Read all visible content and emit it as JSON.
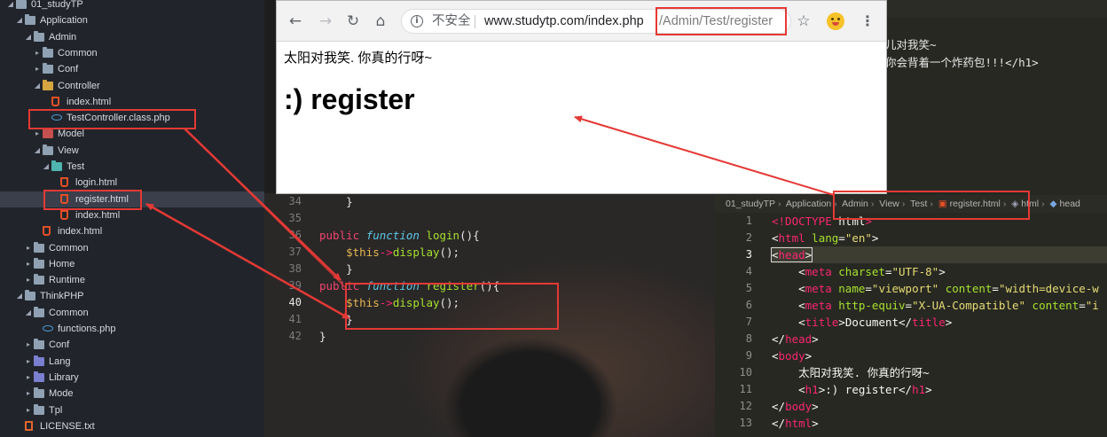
{
  "sidebar": {
    "items": [
      {
        "label": "01_studyTP",
        "depth": 0,
        "expanded": true,
        "icon": "folder-icon"
      },
      {
        "label": "Application",
        "depth": 1,
        "expanded": true,
        "icon": "folder-icon"
      },
      {
        "label": "Admin",
        "depth": 2,
        "expanded": true,
        "icon": "folder-icon"
      },
      {
        "label": "Common",
        "depth": 3,
        "expanded": false,
        "icon": "folder-icon"
      },
      {
        "label": "Conf",
        "depth": 3,
        "expanded": false,
        "icon": "folder-icon"
      },
      {
        "label": "Controller",
        "depth": 3,
        "expanded": true,
        "icon": "folder-icon"
      },
      {
        "label": "index.html",
        "depth": 4,
        "icon": "html5-icon"
      },
      {
        "label": "TestController.class.php",
        "depth": 4,
        "icon": "php-icon"
      },
      {
        "label": "Model",
        "depth": 3,
        "expanded": false,
        "icon": "folder-icon"
      },
      {
        "label": "View",
        "depth": 3,
        "expanded": true,
        "icon": "folder-icon"
      },
      {
        "label": "Test",
        "depth": 4,
        "expanded": true,
        "icon": "folder-icon"
      },
      {
        "label": "login.html",
        "depth": 5,
        "icon": "html5-icon"
      },
      {
        "label": "register.html",
        "depth": 5,
        "icon": "html5-icon",
        "selected": true
      },
      {
        "label": "index.html",
        "depth": 5,
        "icon": "html5-icon"
      },
      {
        "label": "index.html",
        "depth": 3,
        "icon": "html5-icon"
      },
      {
        "label": "Common",
        "depth": 2,
        "expanded": false,
        "icon": "folder-icon"
      },
      {
        "label": "Home",
        "depth": 2,
        "expanded": false,
        "icon": "folder-icon"
      },
      {
        "label": "Runtime",
        "depth": 2,
        "expanded": false,
        "icon": "folder-icon"
      },
      {
        "label": "ThinkPHP",
        "depth": 1,
        "expanded": true,
        "icon": "folder-icon"
      },
      {
        "label": "Common",
        "depth": 2,
        "expanded": true,
        "icon": "folder-icon"
      },
      {
        "label": "functions.php",
        "depth": 3,
        "icon": "php-icon"
      },
      {
        "label": "Conf",
        "depth": 2,
        "expanded": false,
        "icon": "folder-icon"
      },
      {
        "label": "Lang",
        "depth": 2,
        "expanded": false,
        "icon": "folder-icon"
      },
      {
        "label": "Library",
        "depth": 2,
        "expanded": false,
        "icon": "folder-icon"
      },
      {
        "label": "Mode",
        "depth": 2,
        "expanded": false,
        "icon": "folder-icon"
      },
      {
        "label": "Tpl",
        "depth": 2,
        "expanded": false,
        "icon": "folder-icon"
      },
      {
        "label": "LICENSE.txt",
        "depth": 1,
        "icon": "file-icon"
      }
    ]
  },
  "center_editor": {
    "line_numbers": [
      "34",
      "35",
      "36",
      "37",
      "38",
      "39",
      "40",
      "41",
      "42"
    ],
    "active_line": "40",
    "lines": [
      {
        "indent": "    ",
        "text": "}"
      },
      {
        "indent": "",
        "text": ""
      },
      {
        "kw": "public",
        "fkw": "function",
        "name": "login",
        "rest": "(){"
      },
      {
        "var": "$this",
        "arrow": "->",
        "call": "display",
        "rest": "();"
      },
      {
        "indent": "    ",
        "text": "}"
      },
      {
        "kw": "public",
        "fkw": "function",
        "name": "register",
        "rest": "(){"
      },
      {
        "var": "$this",
        "arrow": "->",
        "call": "display",
        "rest": "();"
      },
      {
        "indent": "    ",
        "text": "}"
      },
      {
        "indent": "",
        "text": "}"
      }
    ]
  },
  "right_editor": {
    "top_lines": [
      "儿对我笑~",
      "你会背着一个炸药包!!!</h1>"
    ],
    "breadcrumb": [
      "01_studyTP",
      "Application",
      "Admin",
      "View",
      "Test",
      "register.html",
      "html",
      "head"
    ],
    "line_numbers": [
      "1",
      "2",
      "3",
      "4",
      "5",
      "6",
      "7",
      "8",
      "9",
      "10",
      "11",
      "12",
      "13"
    ],
    "active_line": "3",
    "code": {
      "l1_a": "<!DOCTYPE ",
      "l1_b": "html",
      "l1_c": ">",
      "l2_open": "<",
      "l2_tag": "html",
      "l2_attr": "lang",
      "l2_eq": "=",
      "l2_val": "\"en\"",
      "l2_close": ">",
      "l3_open": "<",
      "l3_tag": "head",
      "l3_close": ">",
      "l4_tag": "meta",
      "l4_attr": "charset",
      "l4_val": "\"UTF-8\"",
      "l5_tag": "meta",
      "l5_attr1": "name",
      "l5_val1": "\"viewport\"",
      "l5_attr2": "content",
      "l5_val2": "\"width=device-w",
      "l6_tag": "meta",
      "l6_attr1": "http-equiv",
      "l6_val1": "\"X-UA-Compatible\"",
      "l6_attr2": "content",
      "l6_val2": "\"i",
      "l7_tag": "title",
      "l7_text": "Document",
      "l8_tag": "head",
      "l9_tag": "body",
      "l10_text": "太阳对我笑. 你真的行呀~",
      "l11_tag": "h1",
      "l11_text": ":) register",
      "l12_tag": "body",
      "l13_tag": "html"
    }
  },
  "browser": {
    "back_glyph": "←",
    "forward_glyph": "→",
    "reload_glyph": "↻",
    "home_glyph": "⌂",
    "info_glyph": "i",
    "insecure_label": "不安全",
    "url_host": "www.studytp.com/index.php",
    "url_path": "/Admin/Test/register",
    "star_glyph": "☆",
    "menu_glyph": "⋮",
    "page_text": "太阳对我笑. 你真的行呀~",
    "page_heading": ":) register"
  },
  "colors": {
    "annotation_red": "#e53935",
    "sidebar_bg": "#21252b",
    "editor_bg": "#272822"
  }
}
